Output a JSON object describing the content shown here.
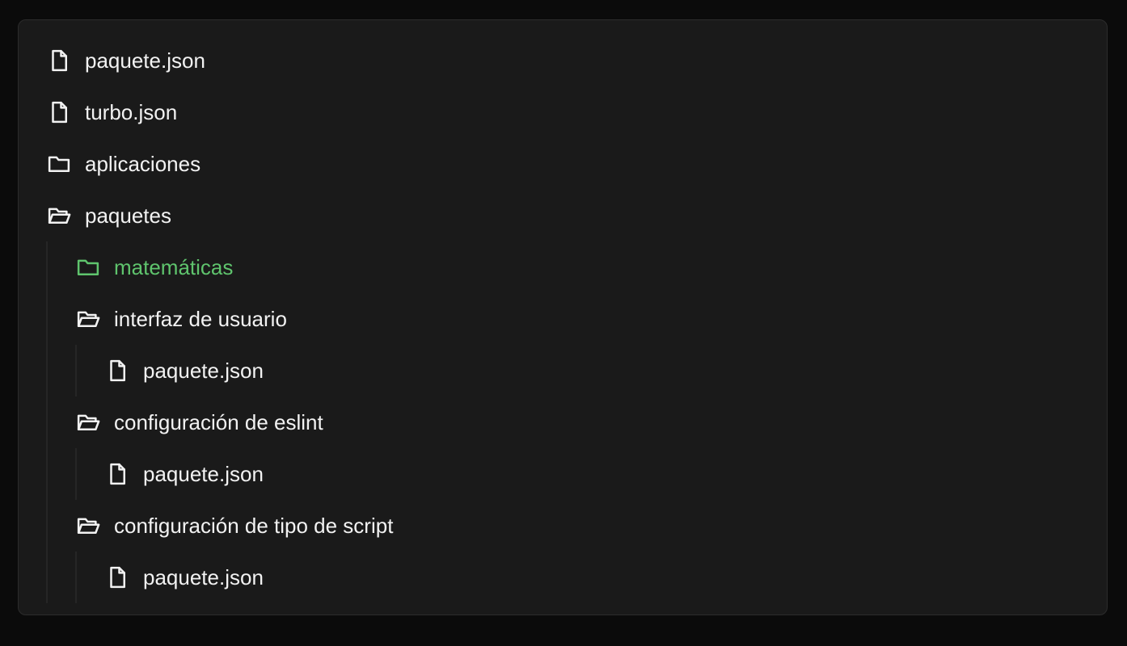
{
  "tree": {
    "root": [
      {
        "label": "paquete.json",
        "icon": "file-icon"
      },
      {
        "label": "turbo.json",
        "icon": "file-icon"
      },
      {
        "label": "aplicaciones",
        "icon": "folder-icon"
      },
      {
        "label": "paquetes",
        "icon": "folder-open-icon"
      }
    ],
    "paquetes_children": [
      {
        "label": "matemáticas",
        "icon": "folder-icon",
        "highlight_color": "#5fc46d"
      },
      {
        "label": "interfaz de usuario",
        "icon": "folder-open-icon"
      },
      {
        "label": "paquete.json",
        "icon": "file-icon"
      },
      {
        "label": "configuración de eslint",
        "icon": "folder-open-icon"
      },
      {
        "label": "paquete.json",
        "icon": "file-icon"
      },
      {
        "label": "configuración de tipo de script",
        "icon": "folder-open-icon"
      },
      {
        "label": "paquete.json",
        "icon": "file-icon"
      }
    ]
  },
  "colors": {
    "background": "#0b0b0b",
    "panel": "#1a1a1a",
    "text": "#f2f2f2",
    "highlight": "#5fc46d"
  }
}
